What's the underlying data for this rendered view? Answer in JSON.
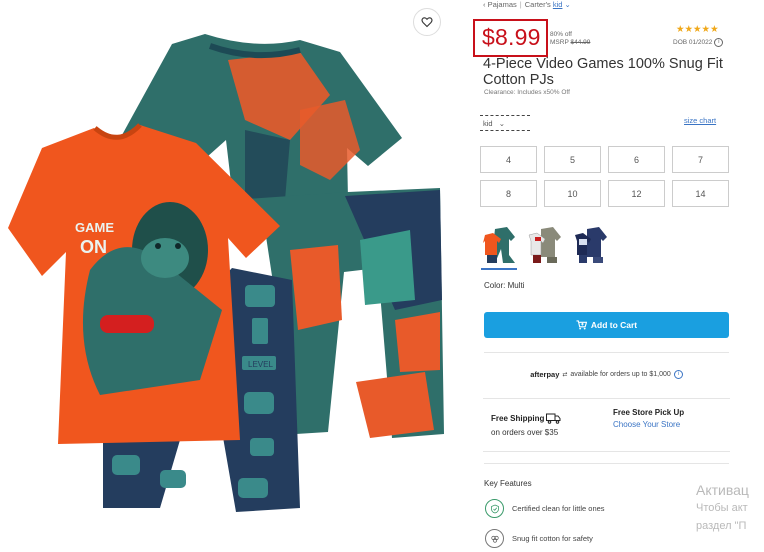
{
  "breadcrumb": {
    "category": "Pajamas",
    "brand": "Carter's",
    "size_group": "kid"
  },
  "price": {
    "current": "$8.99",
    "percent_off": "80% off",
    "msrp_label": "MSRP",
    "msrp": "$44.99"
  },
  "rating": {
    "stars": "★★★★★",
    "dob": "DOB 01/2022",
    "star_color": "#f0a81a"
  },
  "product": {
    "title": "4-Piece Video Games 100% Snug Fit Cotton PJs",
    "clearance": "Clearance: Includes x50% Off"
  },
  "size_selector": {
    "value": "kid",
    "size_chart_label": "size chart"
  },
  "sizes": [
    "4",
    "5",
    "6",
    "7",
    "8",
    "10",
    "12",
    "14"
  ],
  "color": {
    "label": "Color: Multi"
  },
  "cart": {
    "add_to_cart_label": "Add to Cart",
    "button_color": "#1a9fe0"
  },
  "afterpay": {
    "logo": "afterpay",
    "text": "available for orders up to $1,000"
  },
  "shipping": {
    "free_shipping": "Free Shipping",
    "ship_condition": "on orders over $35",
    "pickup_title": "Free Store Pick Up",
    "pickup_link": "Choose Your Store"
  },
  "key_features": {
    "title": "Key Features",
    "items": [
      "Certified clean for little ones",
      "Snug fit cotton for safety"
    ]
  },
  "image_text": {
    "game": "GAME",
    "on": "ON",
    "level": "LEVEL"
  },
  "watermark": {
    "line1": "Активац",
    "line2": "Чтобы акт",
    "line3": "раздел \"П"
  },
  "colors": {
    "price_red": "#c8101a",
    "link_blue": "#3a74c4",
    "accent_blue": "#1a9fe0"
  }
}
